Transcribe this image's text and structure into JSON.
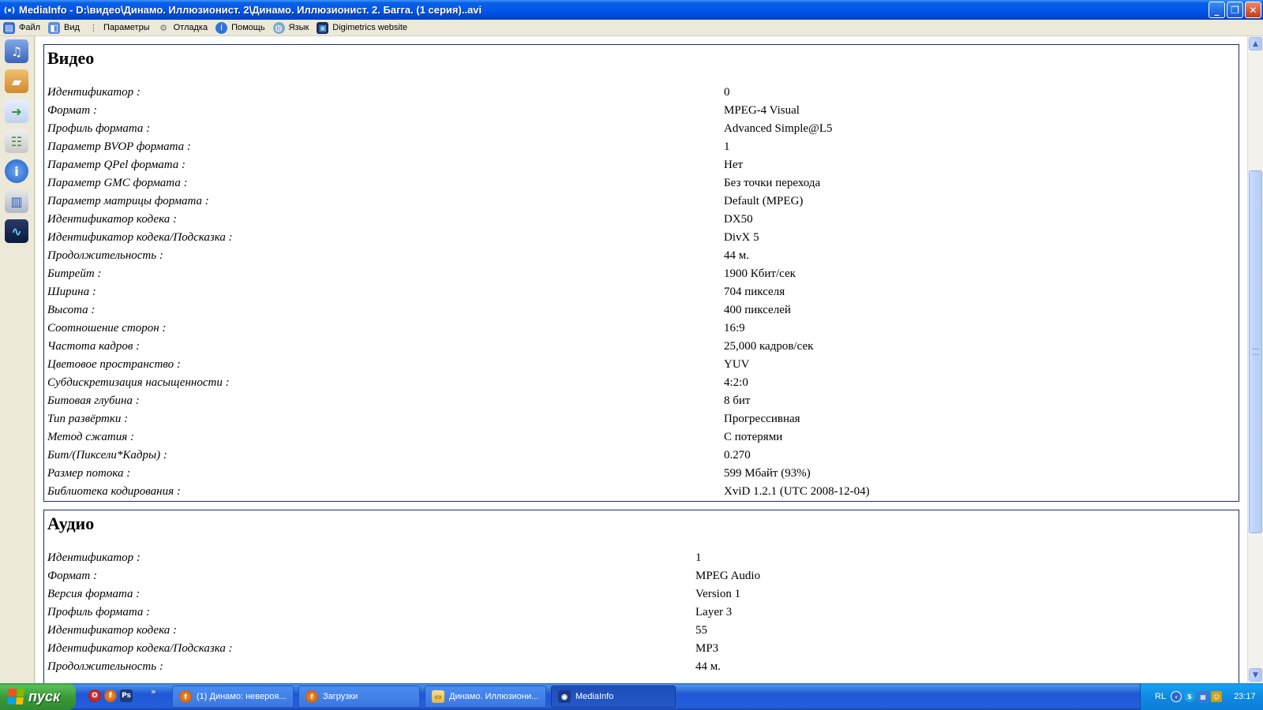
{
  "window": {
    "title": "MediaInfo - D:\\видео\\Динамо. Иллюзионист. 2\\Динамо. Иллюзионист. 2. Багга. (1 серия)..avi",
    "minimize": "_",
    "maximize": "❐",
    "close": "✕"
  },
  "menu": {
    "items": [
      {
        "label": "Файл",
        "icon": "file-icon"
      },
      {
        "label": "Вид",
        "icon": "view-icon"
      },
      {
        "label": "Параметры",
        "icon": "options-icon"
      },
      {
        "label": "Отладка",
        "icon": "debug-icon"
      },
      {
        "label": "Помощь",
        "icon": "help-icon"
      },
      {
        "label": "Язык",
        "icon": "language-icon"
      },
      {
        "label": "Digimetrics website",
        "icon": "digimetrics-icon"
      }
    ]
  },
  "video": {
    "title": "Видео",
    "rows": [
      {
        "key": "Идентификатор :",
        "value": "0"
      },
      {
        "key": "Формат :",
        "value": "MPEG-4 Visual"
      },
      {
        "key": "Профиль формата :",
        "value": "Advanced Simple@L5"
      },
      {
        "key": "Параметр BVOP формата :",
        "value": "1"
      },
      {
        "key": "Параметр QPel формата :",
        "value": "Нет"
      },
      {
        "key": "Параметр GMC формата :",
        "value": "Без точки перехода"
      },
      {
        "key": "Параметр матрицы формата :",
        "value": "Default (MPEG)"
      },
      {
        "key": "Идентификатор кодека :",
        "value": "DX50"
      },
      {
        "key": "Идентификатор кодека/Подсказка :",
        "value": "DivX 5"
      },
      {
        "key": "Продолжительность :",
        "value": "44 м."
      },
      {
        "key": "Битрейт :",
        "value": "1900 Кбит/сек"
      },
      {
        "key": "Ширина :",
        "value": "704 пикселя"
      },
      {
        "key": "Высота :",
        "value": "400 пикселей"
      },
      {
        "key": "Соотношение сторон :",
        "value": "16:9"
      },
      {
        "key": "Частота кадров :",
        "value": "25,000 кадров/сек"
      },
      {
        "key": "Цветовое пространство :",
        "value": "YUV"
      },
      {
        "key": "Субдискретизация насыщенности :",
        "value": "4:2:0"
      },
      {
        "key": "Битовая глубина :",
        "value": "8 бит"
      },
      {
        "key": "Тип развёртки :",
        "value": "Прогрессивная"
      },
      {
        "key": "Метод сжатия :",
        "value": "С потерями"
      },
      {
        "key": "Бит/(Пиксели*Кадры) :",
        "value": "0.270"
      },
      {
        "key": "Размер потока :",
        "value": "599 Мбайт (93%)"
      },
      {
        "key": "Библиотека кодирования :",
        "value": "XviD 1.2.1 (UTC 2008-12-04)"
      }
    ]
  },
  "audio": {
    "title": "Аудио",
    "rows": [
      {
        "key": "Идентификатор :",
        "value": "1"
      },
      {
        "key": "Формат :",
        "value": "MPEG Audio"
      },
      {
        "key": "Версия формата :",
        "value": "Version 1"
      },
      {
        "key": "Профиль формата :",
        "value": "Layer 3"
      },
      {
        "key": "Идентификатор кодека :",
        "value": "55"
      },
      {
        "key": "Идентификатор кодека/Подсказка :",
        "value": "MP3"
      },
      {
        "key": "Продолжительность :",
        "value": "44 м."
      }
    ]
  },
  "taskbar": {
    "start_label": "пуск",
    "quick_more": "»",
    "tasks": [
      {
        "label": "(1) Динамо: невероя...",
        "icon": "firefox-icon"
      },
      {
        "label": "Загрузки",
        "icon": "firefox-icon"
      },
      {
        "label": "Динамо. Иллюзиони...",
        "icon": "folder-icon"
      },
      {
        "label": "MediaInfo",
        "icon": "mediainfo-icon"
      }
    ],
    "tray_lang": "RL",
    "clock": "23:17"
  },
  "colors": {
    "title_bar": "#0058EE",
    "section_border": "#1C2A6B",
    "taskbar": "#245EDB",
    "start_button": "#3A9A3A"
  }
}
